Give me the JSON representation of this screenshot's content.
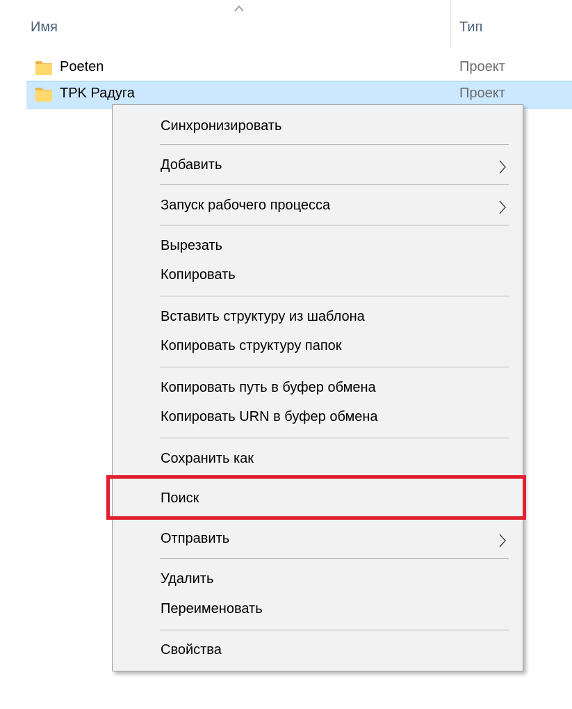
{
  "header": {
    "name_col": "Имя",
    "type_col": "Тип"
  },
  "files": [
    {
      "name": "Poeten",
      "type": "Проект"
    },
    {
      "name": "TPK Радуга",
      "type": "Проект"
    }
  ],
  "menu": {
    "sync": "Синхронизировать",
    "add": "Добавить",
    "workflow": "Запуск рабочего процесса",
    "cut": "Вырезать",
    "copy": "Копировать",
    "paste_template": "Вставить структуру из шаблона",
    "copy_folder_structure": "Копировать структуру папок",
    "copy_path": "Копировать путь в буфер обмена",
    "copy_urn": "Копировать URN в буфер обмена",
    "save_as": "Сохранить как",
    "search": "Поиск",
    "send": "Отправить",
    "delete": "Удалить",
    "rename": "Переименовать",
    "properties": "Свойства"
  },
  "colors": {
    "selection": "#cce8ff",
    "highlight_border": "#e0202f",
    "folder": "#ffd86e"
  },
  "icons": {
    "sort": "chevron-up-icon",
    "folder": "folder-icon",
    "submenu": "chevron-right-icon"
  }
}
